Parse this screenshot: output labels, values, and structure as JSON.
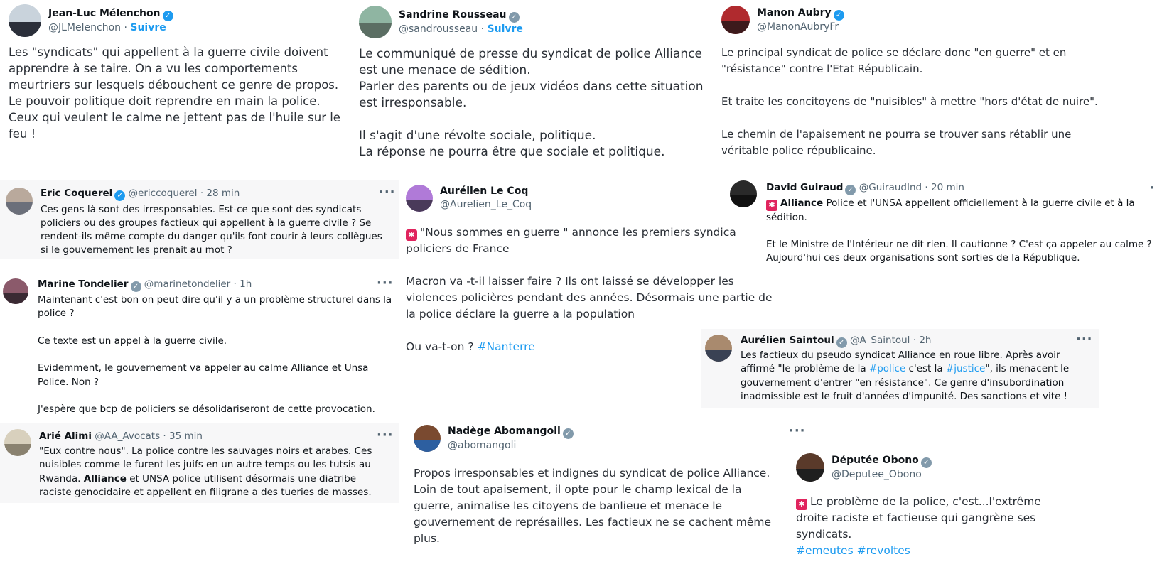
{
  "colors": {
    "accent": "#1d9bf0",
    "verified": "#1d9bf0",
    "verified_grey": "#829aab",
    "card_bg": "#f7f7f8",
    "siren": "#e0245e"
  },
  "icons": {
    "verified": "verified-badge-icon",
    "more": "more-options-icon",
    "siren": "siren-emoji-icon"
  },
  "tweets": {
    "melenchon": {
      "name": "Jean-Luc Mélenchon",
      "handle": "@JLMelenchon",
      "sep": "·",
      "follow": "Suivre",
      "text": "Les \"syndicats\" qui appellent à la guerre civile doivent apprendre à se taire. On a vu les comportements meurtriers sur lesquels débouchent ce genre de propos. Le pouvoir politique doit reprendre en main la police. Ceux qui veulent le calme ne jettent pas de l'huile sur le feu !"
    },
    "rousseau": {
      "name": "Sandrine Rousseau",
      "handle": "@sandrousseau",
      "sep": "·",
      "follow": "Suivre",
      "text": "Le communiqué de presse du syndicat de police Alliance est une menace de sédition.\nParler des parents ou de jeux vidéos dans cette situation est irresponsable.\n\nIl s'agit d'une révolte sociale, politique.\nLa réponse ne pourra être que sociale et politique."
    },
    "aubry": {
      "name": "Manon Aubry",
      "handle": "@ManonAubryFr",
      "text": "Le principal syndicat de police se déclare donc \"en guerre\" et en \"résistance\" contre l'Etat Républicain.\n\nEt traite les concitoyens de \"nuisibles\" à mettre \"hors d'état de nuire\".\n\nLe chemin de l'apaisement ne pourra se trouver sans rétablir une véritable police républicaine."
    },
    "coquerel": {
      "name": "Eric Coquerel",
      "handle": "@ericcoquerel",
      "sep": "·",
      "time": "28 min",
      "more": "···",
      "text": "Ces gens là sont des irresponsables. Est-ce que sont des syndicats policiers ou des groupes factieux qui appellent à la guerre civile ? Se rendent-ils même compte du danger qu'ils font courir à leurs collègues si le gouvernement les prenait au mot ?"
    },
    "lecoq": {
      "name": "Aurélien Le Coq",
      "handle": "@Aurelien_Le_Coq",
      "text_lead": "\"Nous sommes en guerre \" annonce les premiers syndica policiers de France\n\nMacron va -t-il laisser faire ? Ils ont laissé se développer les violences policières pendant des années. Désormais une partie de la police déclare la guerre a la population\n\nOu va-t-on ? ",
      "hashtag": "#Nanterre"
    },
    "guiraud": {
      "name": "David Guiraud",
      "handle": "@GuiraudInd",
      "sep": "·",
      "time": "20 min",
      "more": "·",
      "bold": "Alliance",
      "text_a": " Police et l'UNSA appellent officiellement à la guerre civile et à la sédition.",
      "text_b": "Et le Ministre de l'Intérieur ne dit rien. Il cautionne ? C'est ça appeler au calme ? Aujourd'hui ces deux organisations sont sorties de la République."
    },
    "tondelier": {
      "name": "Marine Tondelier",
      "handle": "@marinetondelier",
      "sep": "·",
      "time": "1h",
      "more": "···",
      "text": "Maintenant c'est bon on peut dire qu'il y a un problème structurel dans la police ?\n\nCe texte est un appel à la guerre civile.\n\nEvidemment, le gouvernement va appeler au calme Alliance et Unsa Police. Non ?\n\nJ'espère que bcp de policiers se désolidariseront de cette provocation."
    },
    "saintoul": {
      "name": "Aurélien Saintoul",
      "handle": "@A_Saintoul",
      "sep": "·",
      "time": "2h",
      "more": "···",
      "t1": "Les factieux du pseudo syndicat Alliance en roue libre. Après avoir affirmé \"le problème de la ",
      "h1": "#police",
      "t2": " c'est la ",
      "h2": "#justice",
      "t3": "\", ils menacent le gouvernement d'entrer \"en résistance\". Ce genre d'insubordination inadmissible est le fruit d'années d'impunité. Des sanctions et vite !"
    },
    "alimi": {
      "name": "Arié Alimi",
      "handle": "@AA_Avocats",
      "sep": "·",
      "time": "35 min",
      "more": "···",
      "text_a": "\"Eux contre nous\". La police contre les sauvages noirs et arabes. Ces nuisibles comme le furent les juifs en un autre temps ou les tutsis au Rwanda. ",
      "bold": "Alliance",
      "text_b": " et UNSA police utilisent désormais une diatribe raciste genocidaire et appellent en filigrane a des tueries de masses."
    },
    "abomangoli": {
      "name": "Nadège Abomangoli",
      "handle": "@abomangoli",
      "more": "···",
      "text": "Propos irresponsables et indignes du syndicat de police Alliance. Loin de tout apaisement, il opte pour le champ lexical de la guerre, animalise les citoyens de banlieue et menace le gouvernement de représailles. Les factieux ne se cachent même plus."
    },
    "obono": {
      "name": "Députée Obono",
      "handle": "@Deputee_Obono",
      "text": "Le problème de la police, c'est...l'extrême droite raciste et factieuse qui gangrène ses syndicats.",
      "h1": "#emeutes",
      "h2": "#revoltes"
    }
  }
}
